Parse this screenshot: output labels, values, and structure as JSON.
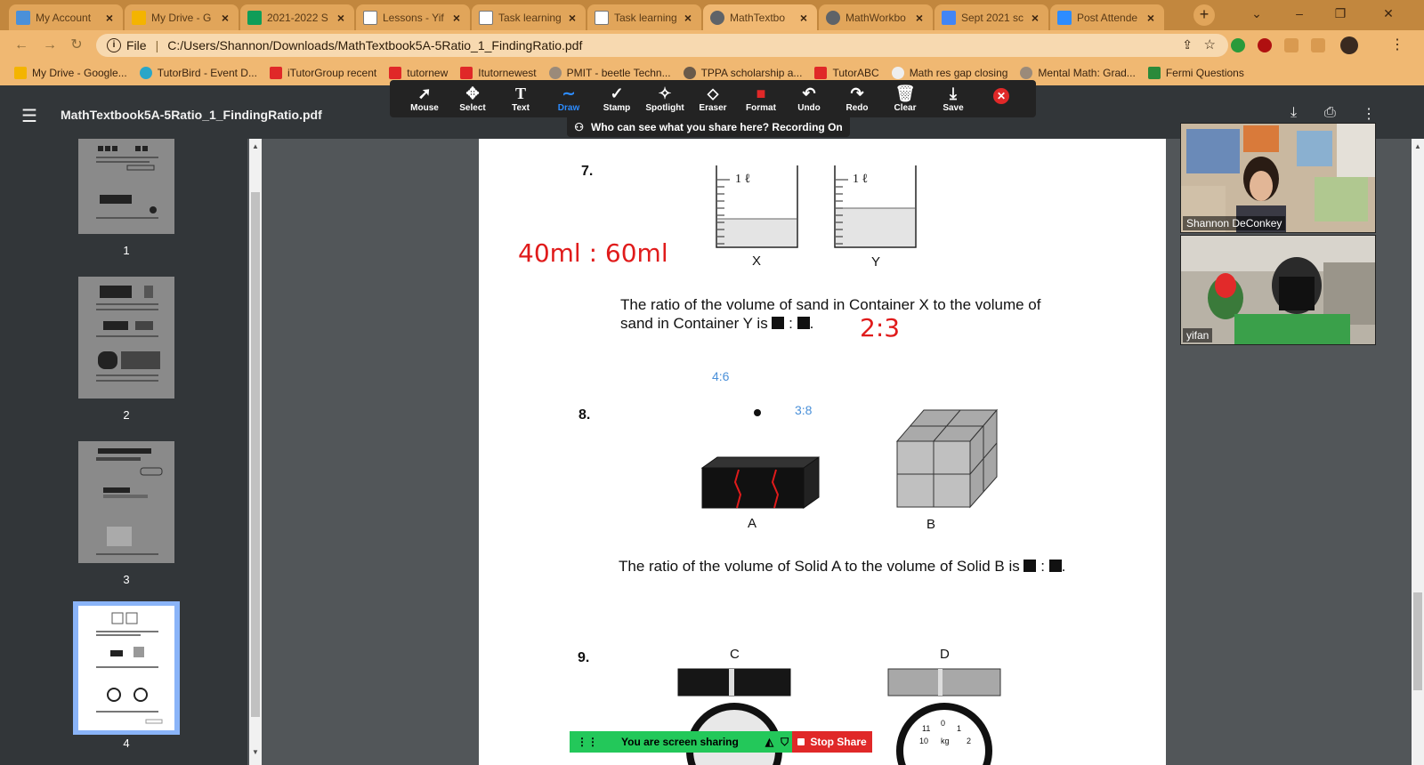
{
  "tabs": [
    {
      "title": "My Account",
      "color": "#4a90d9"
    },
    {
      "title": "My Drive - G",
      "color": "#f4b400"
    },
    {
      "title": "2021-2022 S",
      "color": "#0f9d58"
    },
    {
      "title": "Lessons - Yif",
      "color": "#ffffff"
    },
    {
      "title": "Task learning",
      "color": "#ffffff"
    },
    {
      "title": "Task learning",
      "color": "#ffffff"
    },
    {
      "title": "MathTextbo",
      "color": "#5f6368"
    },
    {
      "title": "MathWorkbo",
      "color": "#5f6368"
    },
    {
      "title": "Sept 2021 sc",
      "color": "#4285f4"
    },
    {
      "title": "Post Attende",
      "color": "#2d8cff"
    }
  ],
  "address": {
    "scheme": "File",
    "url": "C:/Users/Shannon/Downloads/MathTextbook5A-5Ratio_1_FindingRatio.pdf"
  },
  "bookmarks": [
    {
      "label": "My Drive - Google...",
      "color": "#f4b400"
    },
    {
      "label": "TutorBird - Event D...",
      "color": "#2aa6c8"
    },
    {
      "label": "iTutorGroup recent",
      "color": "#e02828"
    },
    {
      "label": "tutornew",
      "color": "#e02828"
    },
    {
      "label": "Itutornewest",
      "color": "#e02828"
    },
    {
      "label": "PMIT - beetle Techn...",
      "color": "#9a8a7a"
    },
    {
      "label": "TPPA scholarship a...",
      "color": "#6a5a4a"
    },
    {
      "label": "TutorABC",
      "color": "#e02828"
    },
    {
      "label": "Math res gap closing",
      "color": "#eeeeee"
    },
    {
      "label": "Mental Math: Grad...",
      "color": "#9a8a7a"
    },
    {
      "label": "Fermi Questions",
      "color": "#2a8a3a"
    }
  ],
  "pdf": {
    "filename": "MathTextbook5A-5Ratio_1_FindingRatio.pdf"
  },
  "draw_tools": [
    {
      "label": "Mouse",
      "icon": "➚"
    },
    {
      "label": "Select",
      "icon": "✥"
    },
    {
      "label": "Text",
      "icon": "T"
    },
    {
      "label": "Draw",
      "icon": "∼"
    },
    {
      "label": "Stamp",
      "icon": "✓"
    },
    {
      "label": "Spotlight",
      "icon": "✧"
    },
    {
      "label": "Eraser",
      "icon": "⬦"
    },
    {
      "label": "Format",
      "icon": "■"
    },
    {
      "label": "Undo",
      "icon": "↶"
    },
    {
      "label": "Redo",
      "icon": "↷"
    },
    {
      "label": "Clear",
      "icon": "🗑"
    },
    {
      "label": "Save",
      "icon": "⤓"
    }
  ],
  "recording_notice": "Who can see what you share here? Recording On",
  "thumbnails": [
    "1",
    "2",
    "3",
    "4"
  ],
  "questions": {
    "q7": {
      "num": "7.",
      "text_a": "The ratio of the volume of sand in Container X to the volume of",
      "text_b": "sand in Container Y is",
      "label_x": "X",
      "label_y": "Y",
      "container_mark": "1 ℓ"
    },
    "q8": {
      "num": "8.",
      "text": "The ratio of the volume of Solid A to the volume of Solid B is",
      "label_a": "A",
      "label_b": "B"
    },
    "q9": {
      "num": "9.",
      "label_c": "C",
      "label_d": "D",
      "scale_unit": "kg",
      "scale_ticks": [
        "11",
        "0",
        "1",
        "10",
        "2"
      ]
    }
  },
  "annotations": {
    "handwritten_1": "40ml : 60ml",
    "handwritten_2": "2:3",
    "typed_1": "4:6",
    "typed_2": "3:8"
  },
  "participants": [
    {
      "name": "Shannon DeConkey"
    },
    {
      "name": "yifan"
    }
  ],
  "share_bar": {
    "status": "You are screen sharing",
    "stop_label": "Stop Share"
  }
}
